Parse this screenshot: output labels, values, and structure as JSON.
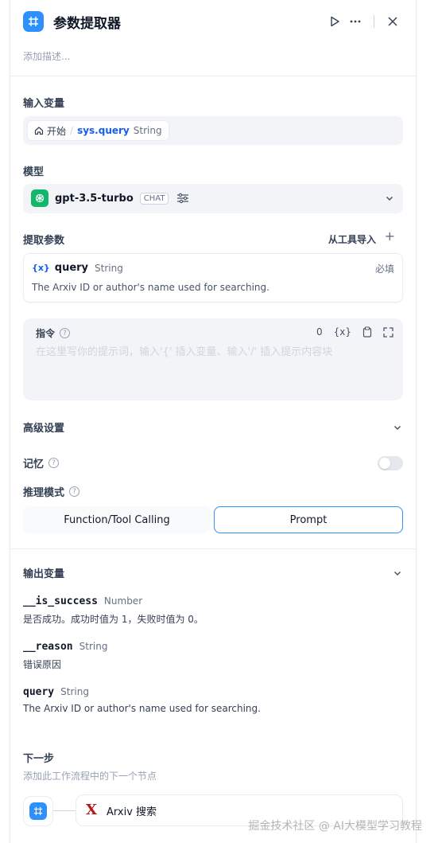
{
  "header": {
    "title": "参数提取器",
    "description_placeholder": "添加描述..."
  },
  "input_variables": {
    "label": "输入变量",
    "chip": {
      "source": "开始",
      "separator": "/",
      "var": "sys.query",
      "type": "String"
    }
  },
  "model": {
    "label": "模型",
    "name": "gpt-3.5-turbo",
    "tag": "CHAT"
  },
  "extract_params": {
    "label": "提取参数",
    "import_label": "从工具导入",
    "add_label": "+",
    "param": {
      "icon_text": "{x}",
      "name": "query",
      "type": "String",
      "required": "必填",
      "description": "The Arxiv ID or author's name used for searching."
    }
  },
  "instruction": {
    "label": "指令",
    "char_count": "0",
    "var_button": "{x}",
    "placeholder": "在这里写你的提示词，输入'{' 插入变量、输入'/' 插入提示内容块"
  },
  "advanced": {
    "label": "高级设置",
    "memory_label": "记忆",
    "memory_enabled": false,
    "reasoning_label": "推理模式",
    "modes": [
      "Function/Tool Calling",
      "Prompt"
    ],
    "selected_mode": "Prompt"
  },
  "output": {
    "label": "输出变量",
    "items": [
      {
        "name": "__is_success",
        "type": "Number",
        "description": "是否成功。成功时值为 1，失败时值为 0。"
      },
      {
        "name": "__reason",
        "type": "String",
        "description": "错误原因"
      },
      {
        "name": "query",
        "type": "String",
        "description": "The Arxiv ID or author's name used for searching."
      }
    ]
  },
  "next_step": {
    "title": "下一步",
    "subtitle": "添加此工作流程中的下一个节点",
    "target": "Arxiv 搜索"
  },
  "watermark": "掘金技术社区 @ AI大模型学习教程",
  "colors": {
    "accent": "#2e90fa",
    "var_blue": "#155eef",
    "gpt_green": "#12b76a",
    "arxiv_red": "#b31b1b"
  }
}
